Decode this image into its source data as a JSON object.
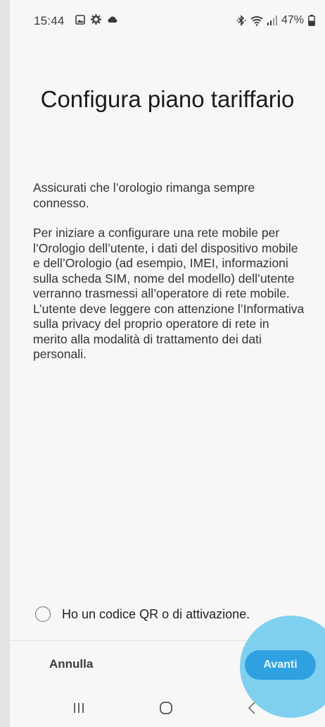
{
  "status_bar": {
    "time": "15:44",
    "battery": "47%",
    "left_icons": [
      "gallery-icon",
      "gear-icon",
      "cloud-icon"
    ],
    "right_icons": [
      "bluetooth-icon",
      "wifi-icon",
      "signal-icon",
      "battery-icon"
    ]
  },
  "page": {
    "title": "Configura piano tariffario",
    "paragraph_1": "Assicurati che l’orologio rimanga sempre connesso.",
    "paragraph_2": "Per iniziare a configurare una rete mobile per l’Orologio dell’utente, i dati del dispositivo mobile e dell’Orologio (ad esempio, IMEI, informazioni sulla scheda SIM, nome del modello) dell’utente verranno trasmessi all’operatore di rete mobile. L’utente deve leggere con attenzione l’Informativa sulla privacy del proprio operatore di rete in merito alla modalità di trattamento dei dati personali."
  },
  "option": {
    "label": "Ho un codice QR o di attivazione.",
    "checked": false
  },
  "actions": {
    "cancel_label": "Annulla",
    "next_label": "Avanti"
  },
  "colors": {
    "accent": "#2fa1e1",
    "touch_highlight": "#7fd0ee",
    "background": "#f7f7f7"
  },
  "nav_bar": {
    "icons": [
      "recents-icon",
      "home-icon",
      "back-icon"
    ]
  }
}
